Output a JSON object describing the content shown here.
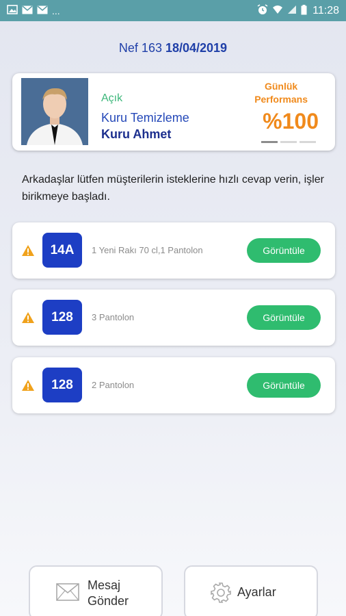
{
  "status_bar": {
    "left_dots": "...",
    "time": "11:28"
  },
  "header": {
    "nef": "Nef 163",
    "date": "18/04/2019"
  },
  "profile": {
    "status": "Açık",
    "company": "Kuru Temizleme",
    "name": "Kuru Ahmet",
    "performance_label_line1": "Günlük",
    "performance_label_line2": "Performans",
    "performance_value": "%100",
    "carousel_active_index": 0
  },
  "notice": "Arkadaşlar lütfen müşterilerin isteklerine hızlı cevap verin, işler birikmeye başladı.",
  "orders": [
    {
      "table": "14A",
      "description": "1 Yeni Rakı 70 cl,1 Pantolon",
      "button": "Görüntüle"
    },
    {
      "table": "128",
      "description": "3 Pantolon",
      "button": "Görüntüle"
    },
    {
      "table": "128",
      "description": "2 Pantolon",
      "button": "Görüntüle"
    }
  ],
  "bottom": {
    "message_line1": "Mesaj",
    "message_line2": "Gönder",
    "settings": "Ayarlar"
  },
  "colors": {
    "status_bar": "#5a9fa8",
    "accent_blue": "#1d3ec4",
    "accent_green": "#2fbc6f",
    "accent_orange": "#f08a1c",
    "warning": "#f0a21c"
  }
}
